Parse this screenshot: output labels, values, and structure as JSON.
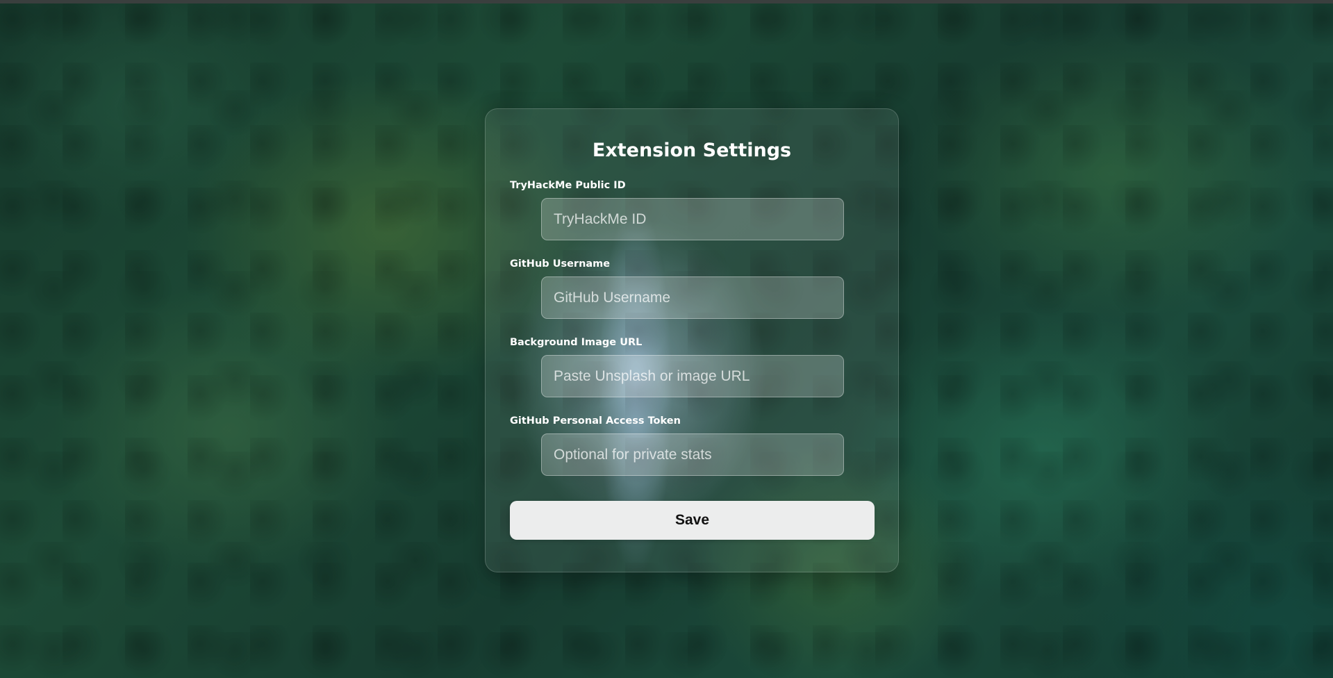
{
  "panel": {
    "title": "Extension Settings"
  },
  "fields": [
    {
      "label": "TryHackMe Public ID",
      "value": "",
      "placeholder": "TryHackMe ID"
    },
    {
      "label": "GitHub Username",
      "value": "",
      "placeholder": "GitHub Username"
    },
    {
      "label": "Background Image URL",
      "value": "",
      "placeholder": "Paste Unsplash or image URL"
    },
    {
      "label": "GitHub Personal Access Token",
      "value": "",
      "placeholder": "Optional for private stats"
    }
  ],
  "actions": {
    "save_label": "Save"
  },
  "colors": {
    "panel_text": "#ffffff",
    "button_bg": "#eceded",
    "button_text": "#111111"
  }
}
